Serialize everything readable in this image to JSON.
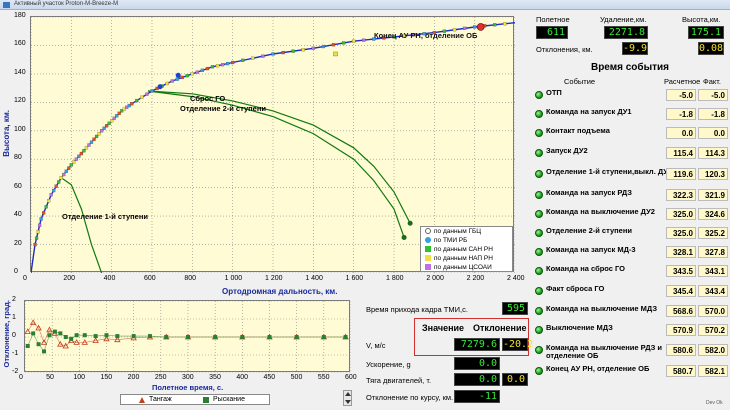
{
  "window": {
    "title": "Активный участок Proton-M-Breeze-M"
  },
  "main_chart": {
    "ylabel": "Высота, км.",
    "xlabel": "Ортодромная дальность, км.",
    "annotations": {
      "end_au": "Конец АУ РН, отделение ОБ",
      "sbros_go": "Сброс ГО",
      "stage2_sep": "Отделение 2-й ступени",
      "stage1_sep": "Отделение 1-й ступени"
    },
    "legend": [
      {
        "label": "по данным ГБЦ",
        "color": "#ffffff",
        "shape": "circle"
      },
      {
        "label": "по ТМИ РБ",
        "color": "#33a0e0",
        "shape": "circle"
      },
      {
        "label": "по данным САН РН",
        "color": "#30c030",
        "shape": "square"
      },
      {
        "label": "по данным НАП РН",
        "color": "#f0e040",
        "shape": "square"
      },
      {
        "label": "по данным ЦСОАИ",
        "color": "#c070e0",
        "shape": "square"
      }
    ]
  },
  "chart_data": [
    {
      "type": "line",
      "xlabel": "Ортодромная дальность, км.",
      "ylabel": "Высота, км.",
      "xlim": [
        0,
        2400
      ],
      "ylim": [
        0,
        180
      ],
      "x_ticks": [
        "0",
        "200",
        "400",
        "600",
        "800",
        "1 000",
        "1 200",
        "1 400",
        "1 600",
        "1 800",
        "2 000",
        "2 200",
        "2 400"
      ],
      "y_ticks": [
        "0",
        "20",
        "40",
        "60",
        "80",
        "100",
        "120",
        "140",
        "160",
        "180"
      ],
      "grid": true,
      "series": [
        {
          "x": [
            0,
            20,
            50,
            100,
            150,
            200,
            250,
            300,
            350,
            400,
            450,
            500,
            600,
            700,
            800,
            900,
            1000,
            1200,
            1400,
            1600,
            1800,
            2000,
            2200,
            2400
          ],
          "y": [
            0,
            20,
            38,
            55,
            67,
            76,
            84,
            92,
            100,
            107,
            114,
            119,
            128,
            135,
            140,
            145,
            148,
            154,
            158,
            163,
            166,
            169,
            173,
            176
          ]
        },
        {
          "x": [
            150,
            200,
            250,
            300,
            350
          ],
          "y": [
            67,
            62,
            45,
            20,
            0
          ]
        },
        {
          "x": [
            580,
            800,
            1000,
            1200,
            1400,
            1600,
            1700,
            1800,
            1850
          ],
          "y": [
            128,
            124,
            118,
            110,
            98,
            80,
            65,
            45,
            25
          ]
        },
        {
          "x": [
            580,
            800,
            1000,
            1200,
            1400,
            1600,
            1700,
            1800,
            1880
          ],
          "y": [
            128,
            126,
            121,
            114,
            104,
            88,
            75,
            57,
            35
          ]
        }
      ]
    },
    {
      "type": "scatter",
      "xlabel": "Полетное время, с.",
      "ylabel": "Отклонение, град.",
      "xlim": [
        0,
        600
      ],
      "ylim": [
        -2,
        2
      ],
      "x_ticks": [
        "0",
        "50",
        "100",
        "150",
        "200",
        "250",
        "300",
        "350",
        "400",
        "450",
        "500",
        "550",
        "600"
      ],
      "y_ticks": [
        "-2",
        "-1",
        "0",
        "1",
        "2"
      ],
      "grid": true,
      "series": [
        {
          "name": "Тангаж",
          "color": "#c04020",
          "shape": "triangle",
          "x": [
            5,
            15,
            25,
            35,
            45,
            55,
            65,
            75,
            85,
            95,
            110,
            130,
            150,
            170,
            200,
            230,
            260,
            300,
            350,
            400,
            450,
            500,
            550,
            590
          ],
          "y": [
            0.3,
            0.8,
            0.5,
            -0.3,
            0.4,
            0.2,
            -0.4,
            -0.5,
            -0.2,
            -0.3,
            -0.3,
            -0.2,
            -0.1,
            -0.15,
            -0.05,
            0,
            0,
            0,
            0,
            0,
            0,
            0,
            0,
            0
          ]
        },
        {
          "name": "Рыскание",
          "color": "#2a8030",
          "shape": "square",
          "x": [
            5,
            15,
            25,
            35,
            45,
            55,
            65,
            75,
            85,
            95,
            110,
            130,
            150,
            170,
            200,
            230,
            260,
            300,
            350,
            400,
            450,
            500,
            550,
            590
          ],
          "y": [
            -0.5,
            0.2,
            -0.4,
            -0.8,
            0.1,
            0.3,
            0.2,
            0.0,
            -0.1,
            0.1,
            0.1,
            0.05,
            0.1,
            0.05,
            0.05,
            0.05,
            0,
            0,
            0,
            0,
            0,
            0,
            0,
            0
          ]
        }
      ]
    }
  ],
  "small_chart": {
    "ylabel": "Отклонение, град.",
    "xlabel": "Полетное время, с.",
    "legend": [
      "Тангаж",
      "Рыскание"
    ]
  },
  "telemetry": {
    "tmi_time_label": "Время прихода кадра ТМИ,с.",
    "tmi_time_value": "595",
    "highlight_title_value": "Значение",
    "highlight_title_dev": "Отклонение",
    "v_label": "V, м/с",
    "v_value": "7279.6",
    "v_dev": "-20.2",
    "accel_label": "Ускорение, g",
    "accel_value": "0.0",
    "thrust_label": "Тяга двигателей, т.",
    "thrust_value": "0.0",
    "thrust_dev": "0.0",
    "course_label": "Отклонение по курсу, км.",
    "course_value": "-11"
  },
  "header_values": {
    "flight_label": "Полетное",
    "flight_value": "611",
    "distance_label": "Удаление,км.",
    "distance_value": "2271.8",
    "height_label": "Высота,км.",
    "height_value": "175.1",
    "deviation_label": "Отклонения, км.",
    "deviation_value_1": "-9.9",
    "deviation_value_2": "0.08"
  },
  "events": {
    "title": "Время события",
    "col_event": "Событие",
    "col_calc": "Расчетное",
    "col_fact": "Факт.",
    "rows": [
      {
        "name": "ОТП",
        "calc": "-5.0",
        "fact": "-5.0"
      },
      {
        "name": "Команда на запуск ДУ1",
        "calc": "-1.8",
        "fact": "-1.8"
      },
      {
        "name": "Контакт подъема",
        "calc": "0.0",
        "fact": "0.0"
      },
      {
        "name": "Запуск ДУ2",
        "calc": "115.4",
        "fact": "114.3"
      },
      {
        "name": "Отделение 1-й ступени,выкл. ДУ1",
        "calc": "119.6",
        "fact": "120.3"
      },
      {
        "name": "Команда на запуск РДЗ",
        "calc": "322.3",
        "fact": "321.9"
      },
      {
        "name": "Команда на выключение ДУ2",
        "calc": "325.0",
        "fact": "324.6"
      },
      {
        "name": "Отделение 2-й ступени",
        "calc": "325.0",
        "fact": "325.2"
      },
      {
        "name": "Команда на запуск МД-3",
        "calc": "328.1",
        "fact": "327.8"
      },
      {
        "name": "Команда на сброс ГО",
        "calc": "343.5",
        "fact": "343.1"
      },
      {
        "name": "Факт сброса ГО",
        "calc": "345.4",
        "fact": "343.4"
      },
      {
        "name": "Команда на выключение МДЗ",
        "calc": "568.6",
        "fact": "570.0"
      },
      {
        "name": "Выключение МДЗ",
        "calc": "570.9",
        "fact": "570.2"
      },
      {
        "name": "Команда на выключение РДЗ и отделение ОБ",
        "calc": "580.6",
        "fact": "582.0"
      },
      {
        "name": "Конец АУ РН, отделение ОБ",
        "calc": "580.7",
        "fact": "582.1"
      }
    ]
  }
}
